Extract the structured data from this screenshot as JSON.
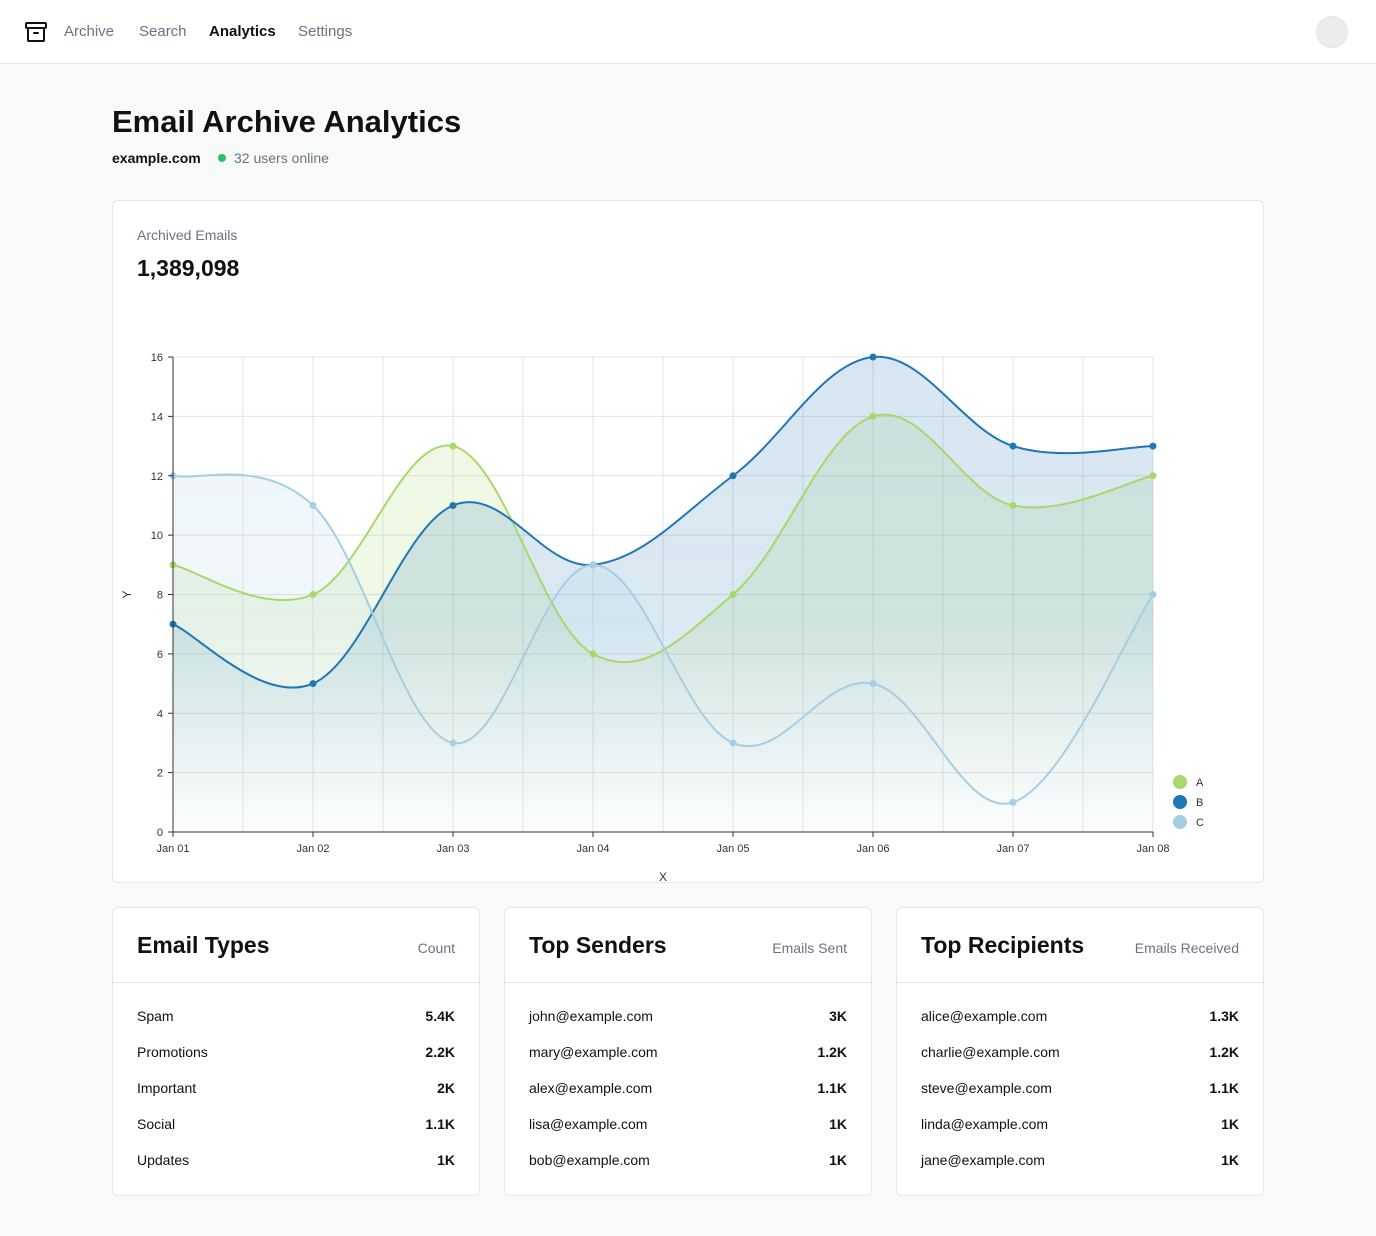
{
  "nav": {
    "links": [
      "Archive",
      "Search",
      "Analytics",
      "Settings"
    ],
    "active": "Analytics"
  },
  "header": {
    "title": "Email Archive Analytics",
    "domain": "example.com",
    "online": "32 users online",
    "online_color": "#22c55e"
  },
  "metric": {
    "label": "Archived Emails",
    "value": "1,389,098"
  },
  "chart_data": {
    "type": "area",
    "x": [
      "Jan 01",
      "Jan 02",
      "Jan 03",
      "Jan 04",
      "Jan 05",
      "Jan 06",
      "Jan 07",
      "Jan 08"
    ],
    "xlabel": "X",
    "ylabel": "Y",
    "ylim": [
      0,
      16
    ],
    "yticks": [
      0,
      2,
      4,
      6,
      8,
      10,
      12,
      14,
      16
    ],
    "grid": true,
    "curve": "smooth",
    "legend_position": "bottom-right",
    "series": [
      {
        "name": "A",
        "color": "#a6d96a",
        "values": [
          9,
          8,
          13,
          6,
          8,
          14,
          11,
          12
        ]
      },
      {
        "name": "B",
        "color": "#1f77b4",
        "values": [
          7,
          5,
          11,
          9,
          12,
          16,
          13,
          13
        ]
      },
      {
        "name": "C",
        "color": "#a6cee3",
        "values": [
          12,
          11,
          3,
          9,
          3,
          5,
          1,
          8
        ]
      }
    ]
  },
  "tables": [
    {
      "title": "Email Types",
      "column": "Count",
      "rows": [
        {
          "label": "Spam",
          "value": "5.4K"
        },
        {
          "label": "Promotions",
          "value": "2.2K"
        },
        {
          "label": "Important",
          "value": "2K"
        },
        {
          "label": "Social",
          "value": "1.1K"
        },
        {
          "label": "Updates",
          "value": "1K"
        }
      ]
    },
    {
      "title": "Top Senders",
      "column": "Emails Sent",
      "rows": [
        {
          "label": "john@example.com",
          "value": "3K"
        },
        {
          "label": "mary@example.com",
          "value": "1.2K"
        },
        {
          "label": "alex@example.com",
          "value": "1.1K"
        },
        {
          "label": "lisa@example.com",
          "value": "1K"
        },
        {
          "label": "bob@example.com",
          "value": "1K"
        }
      ]
    },
    {
      "title": "Top Recipients",
      "column": "Emails Received",
      "rows": [
        {
          "label": "alice@example.com",
          "value": "1.3K"
        },
        {
          "label": "charlie@example.com",
          "value": "1.2K"
        },
        {
          "label": "steve@example.com",
          "value": "1.1K"
        },
        {
          "label": "linda@example.com",
          "value": "1K"
        },
        {
          "label": "jane@example.com",
          "value": "1K"
        }
      ]
    }
  ]
}
